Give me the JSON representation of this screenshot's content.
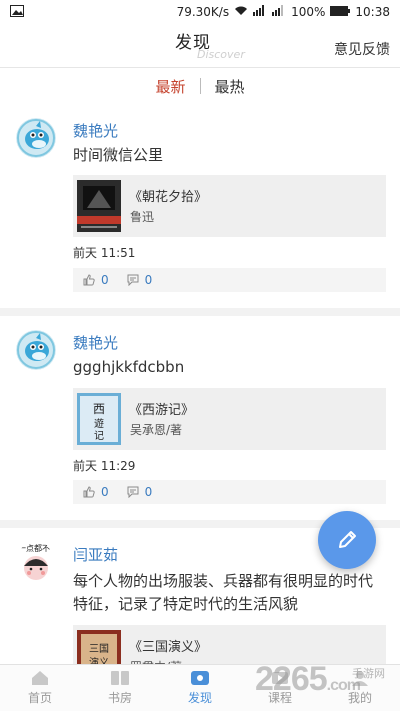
{
  "status_bar": {
    "speed": "79.30K/s",
    "battery": "100%",
    "time": "10:38"
  },
  "header": {
    "title_cn": "发现",
    "title_en": "Discover",
    "feedback": "意见反馈"
  },
  "tabs": [
    {
      "label": "最新",
      "active": true
    },
    {
      "label": "最热",
      "active": false
    }
  ],
  "posts": [
    {
      "user": "魏艳光",
      "content": "时间微信公里",
      "book_title": "《朝花夕拾》",
      "book_author": "鲁迅",
      "time": "前天 11:51",
      "likes": "0",
      "comments": "0"
    },
    {
      "user": "魏艳光",
      "content": "ggghjkkfdcbbn",
      "book_title": "《西游记》",
      "book_author": "吴承恩/著",
      "time": "前天 11:29",
      "likes": "0",
      "comments": "0"
    },
    {
      "user": "闫亚茹",
      "content": "每个人物的出场服装、兵器都有很明显的时代特征，记录了特定时代的生活风貌",
      "book_title": "《三国演义》",
      "book_author": "罗贯中/著",
      "avatar_text": "一点都不"
    }
  ],
  "bottom_nav": [
    {
      "label": "首页",
      "icon": "home-icon",
      "active": false
    },
    {
      "label": "书房",
      "icon": "book-icon",
      "active": false
    },
    {
      "label": "发现",
      "icon": "discover-icon",
      "active": true
    },
    {
      "label": "课程",
      "icon": "course-icon",
      "active": false
    },
    {
      "label": "我的",
      "icon": "profile-icon",
      "active": false
    }
  ],
  "watermark": {
    "main": "2265",
    "suffix": ".com",
    "site_cn": "手游网"
  },
  "colors": {
    "accent": "#4a8fd8",
    "tab_active": "#c5432e",
    "username": "#3a7bbf",
    "fab": "#5a98ea"
  }
}
